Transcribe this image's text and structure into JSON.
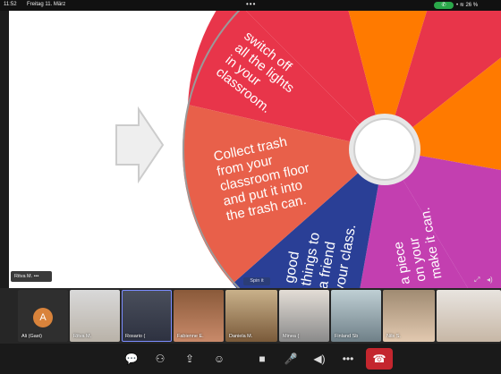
{
  "status": {
    "time": "11:52",
    "date": "Freitag 11. März",
    "dots": "•••",
    "battery": "26 %"
  },
  "presentation": {
    "presenter_name": "Ritva M.",
    "presenter_menu": "•••",
    "spin_label": "Spin it",
    "wheel_segments": [
      {
        "text": [
          "Collect trash",
          "from your",
          "classroom floor",
          "and put it into",
          "the trash can."
        ],
        "color": "#e8604a"
      },
      {
        "text": [
          "switch off",
          "all the lights",
          "in your",
          "classroom."
        ],
        "color": "#e8354a"
      },
      {
        "text": [
          "good",
          "things to",
          "a friend",
          "your class."
        ],
        "color": "#2a3f96"
      },
      {
        "text": [
          "a piece",
          "on your",
          "make it can."
        ],
        "color": "#c33fb0"
      }
    ]
  },
  "participants": [
    {
      "name": "Ali (Gast)",
      "avatar": "A"
    },
    {
      "name": "Ritva M."
    },
    {
      "name": "Rosario ("
    },
    {
      "name": "Fabienne E."
    },
    {
      "name": "Daniela M."
    },
    {
      "name": "Minea ("
    },
    {
      "name": "Finland Sb"
    },
    {
      "name": "Nils S."
    }
  ],
  "toolbar": {
    "end_call_icon": "phone-hangup-icon"
  }
}
